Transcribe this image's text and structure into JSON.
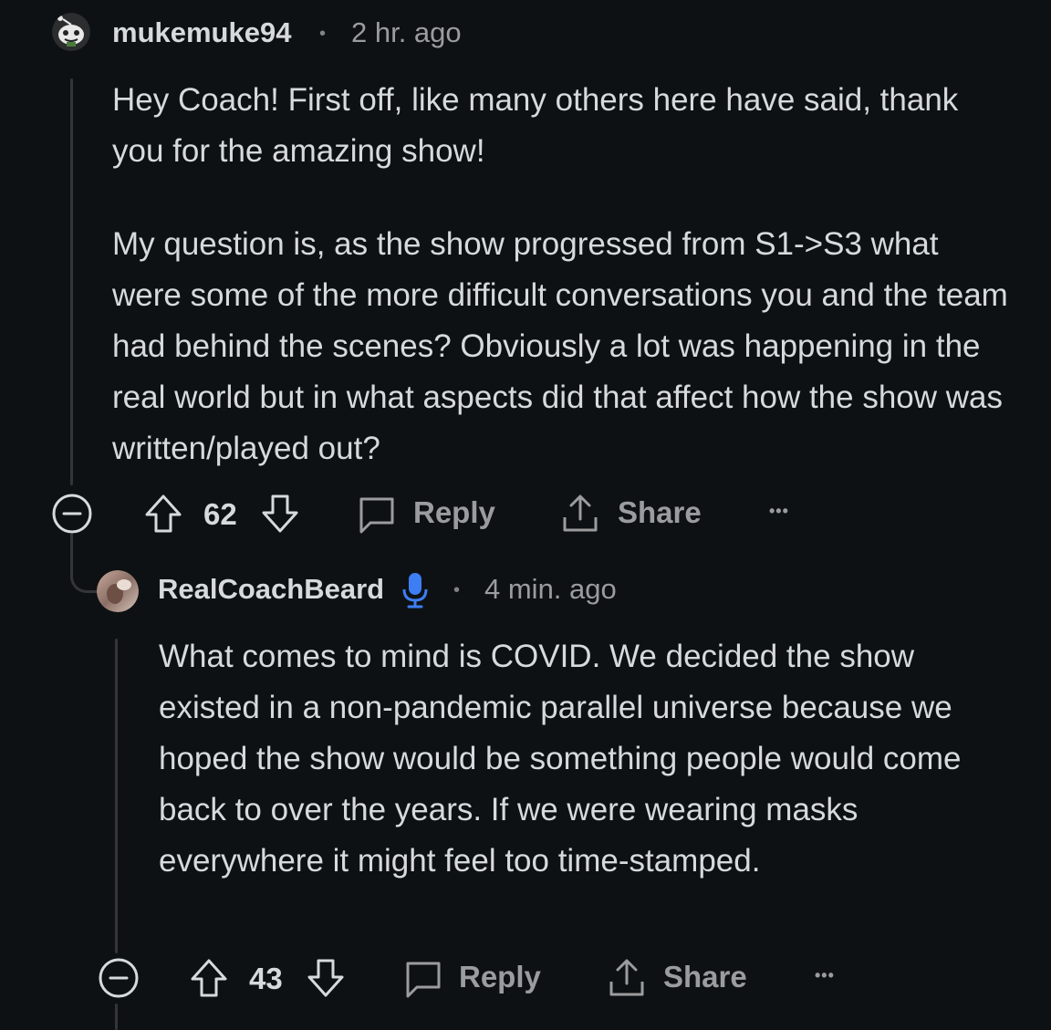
{
  "thread": {
    "comments": [
      {
        "username": "mukemuke94",
        "separator": "•",
        "time": "2 hr. ago",
        "body": [
          "Hey Coach! First off, like many others here have said, thank you for the amazing show!",
          "My question is, as the show progressed from S1->S3 what were some of the more difficult conversations you and the team had behind the scenes? Obviously a lot was happening in the real world but in what aspects did that affect how the show was written/played out?"
        ],
        "votes": "62",
        "reply_label": "Reply",
        "share_label": "Share",
        "more_label": "•••"
      },
      {
        "username": "RealCoachBeard",
        "separator": "•",
        "time": "4 min. ago",
        "body": [
          "What comes to mind is COVID. We decided the show existed in a non-pandemic parallel universe because we hoped the show would be something people would come back to over the years. If we were wearing masks everywhere it might feel too time-stamped."
        ],
        "votes": "43",
        "reply_label": "Reply",
        "share_label": "Share",
        "more_label": "•••"
      }
    ]
  },
  "icons": {
    "avatar_1": "snoo-avatar-icon",
    "avatar_2": "user-photo-avatar",
    "verified": "microphone-icon",
    "collapse": "collapse-minus-icon",
    "upvote": "upvote-arrow-icon",
    "downvote": "downvote-arrow-icon",
    "reply": "chat-bubble-icon",
    "share": "share-upload-icon",
    "more": "more-dots-icon"
  },
  "colors": {
    "background": "#0e1113",
    "text": "#d7dadc",
    "muted": "#9a9c9e",
    "thread_line": "#343536",
    "verified_blue": "#3d7ef5"
  }
}
